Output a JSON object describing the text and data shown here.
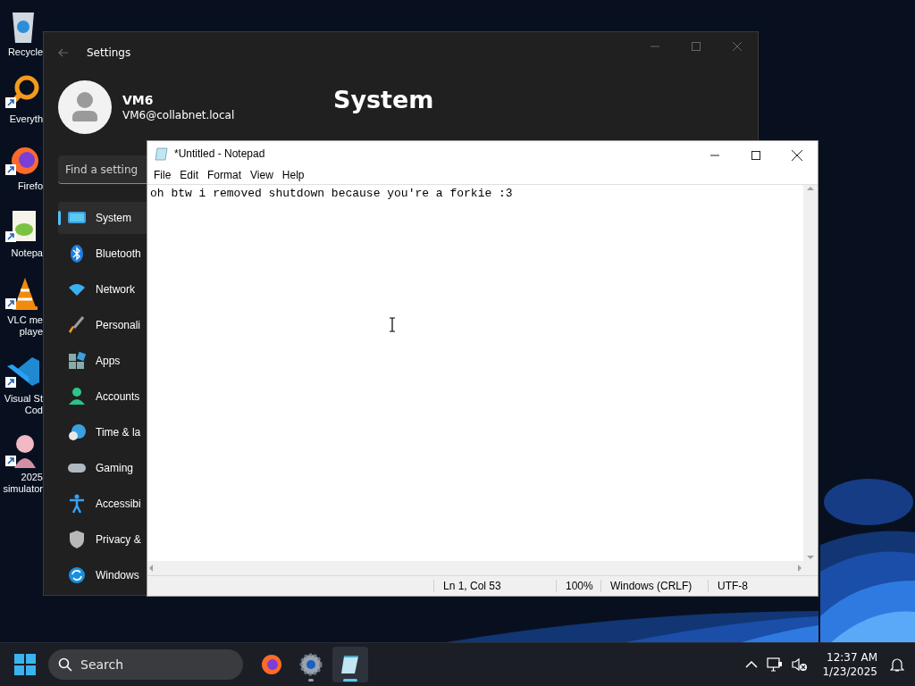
{
  "desktop_icons": [
    {
      "kind": "recycle",
      "lines": [
        "Recycle"
      ],
      "shortcut": false
    },
    {
      "kind": "search-app",
      "lines": [
        "Everyth"
      ],
      "shortcut": true
    },
    {
      "kind": "firefox",
      "lines": [
        "Firefo"
      ],
      "shortcut": true
    },
    {
      "kind": "notepadpp",
      "lines": [
        "Notepa"
      ],
      "shortcut": true
    },
    {
      "kind": "vlc",
      "lines": [
        "VLC me",
        "playe"
      ],
      "shortcut": true
    },
    {
      "kind": "vscode",
      "lines": [
        "Visual St",
        "Cod"
      ],
      "shortcut": true
    },
    {
      "kind": "figure",
      "lines": [
        "2025",
        "simulator"
      ],
      "shortcut": true
    }
  ],
  "settings": {
    "title": "Settings",
    "user": {
      "name": "VM6",
      "email": "VM6@collabnet.local"
    },
    "heading": "System",
    "search": {
      "placeholder": "Find a setting"
    },
    "nav": [
      {
        "label": "System",
        "kind": "system",
        "selected": true
      },
      {
        "label": "Bluetooth",
        "kind": "bluetooth",
        "selected": false
      },
      {
        "label": "Network",
        "kind": "network",
        "selected": false
      },
      {
        "label": "Personali",
        "kind": "brush",
        "selected": false
      },
      {
        "label": "Apps",
        "kind": "apps",
        "selected": false
      },
      {
        "label": "Accounts",
        "kind": "accounts",
        "selected": false
      },
      {
        "label": "Time & la",
        "kind": "time",
        "selected": false
      },
      {
        "label": "Gaming",
        "kind": "gaming",
        "selected": false
      },
      {
        "label": "Accessibi",
        "kind": "accessibility",
        "selected": false
      },
      {
        "label": "Privacy &",
        "kind": "privacy",
        "selected": false
      },
      {
        "label": "Windows",
        "kind": "update",
        "selected": false
      }
    ]
  },
  "notepad": {
    "title": "*Untitled - Notepad",
    "menu": [
      "File",
      "Edit",
      "Format",
      "View",
      "Help"
    ],
    "text": "oh btw i removed shutdown because you're a forkie :3",
    "status": [
      "Ln 1, Col 53",
      "100%",
      "Windows (CRLF)",
      "UTF-8"
    ]
  },
  "taskbar": {
    "search": {
      "placeholder": "Search"
    },
    "apps": [
      {
        "kind": "firefox",
        "selected": false,
        "running": false
      },
      {
        "kind": "settings",
        "selected": false,
        "running": true
      },
      {
        "kind": "notepad",
        "selected": true,
        "running": true
      }
    ],
    "time": "12:37 AM",
    "date": "1/23/2025"
  }
}
